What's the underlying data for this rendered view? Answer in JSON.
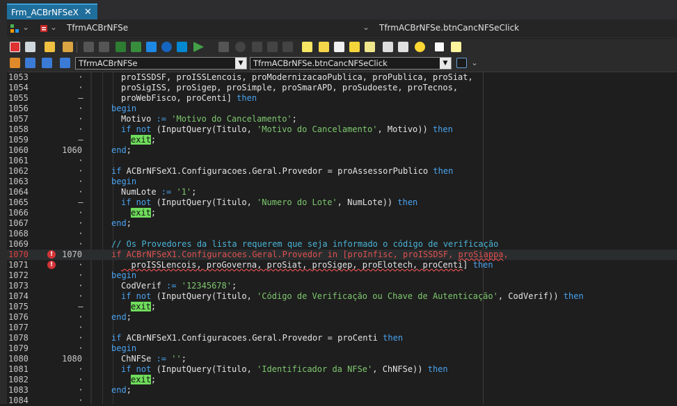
{
  "window": {
    "tab_title": "Frm_ACBrNFSeX",
    "tab_close": "✕"
  },
  "navbar": {
    "unit_class": "TfrmACBrNFSe",
    "method": "TfrmACBrNFSe.btnCancNFSeClick"
  },
  "combo_row": {
    "class_combo": "TfrmACBrNFSe",
    "method_combo": "TfrmACBrNFSe.btnCancNFSeClick"
  },
  "colors": {
    "accent_tab": "#1f6e9c",
    "keyword": "#4aa3f0",
    "string": "#7ec86f",
    "comment": "#4ab3d6",
    "error": "#e05050",
    "exit_highlight": "#6fdc5c"
  },
  "gutter": {
    "error_icon": "error-circle-icon"
  },
  "lines": [
    {
      "n": "1053",
      "m": "",
      "g": "·",
      "tokens": [
        [
          "t",
          "proISSDSF, proISSLencois, proModernizacaoPublica, proPublica, proSiat,"
        ]
      ],
      "indent": 1
    },
    {
      "n": "1054",
      "m": "",
      "g": "·",
      "tokens": [
        [
          "t",
          "proSigISS, proSigep, proSimple, proSmarAPD, proSudoeste, proTecnos,"
        ]
      ],
      "indent": 1
    },
    {
      "n": "1055",
      "m": "",
      "g": "–",
      "tokens": [
        [
          "t",
          "proWebFisco, proCenti] "
        ],
        [
          "kw",
          "then"
        ]
      ],
      "indent": 1
    },
    {
      "n": "1056",
      "m": "",
      "g": "·",
      "tokens": [
        [
          "kw",
          "begin"
        ]
      ],
      "indent": 0
    },
    {
      "n": "1057",
      "m": "",
      "g": "·",
      "tokens": [
        [
          "t",
          "Motivo "
        ],
        [
          "kw",
          ":="
        ],
        [
          "t",
          " "
        ],
        [
          "str",
          "'Motivo do Cancelamento'"
        ],
        [
          "t",
          ";"
        ]
      ],
      "indent": 1
    },
    {
      "n": "1058",
      "m": "",
      "g": "·",
      "tokens": [
        [
          "kw",
          "if not"
        ],
        [
          "t",
          " (InputQuery(Titulo, "
        ],
        [
          "str",
          "'Motivo do Cancelamento'"
        ],
        [
          "t",
          ", Motivo)) "
        ],
        [
          "kw",
          "then"
        ]
      ],
      "indent": 1
    },
    {
      "n": "1059",
      "m": "",
      "g": "–",
      "tokens": [
        [
          "exit",
          "exit"
        ],
        [
          "t",
          ";"
        ]
      ],
      "indent": 2
    },
    {
      "n": "1060",
      "m": "1060",
      "g": "·",
      "tokens": [
        [
          "kw",
          "end"
        ],
        [
          "t",
          ";"
        ]
      ],
      "indent": 0
    },
    {
      "n": "1061",
      "m": "",
      "g": "·",
      "tokens": [],
      "indent": 0
    },
    {
      "n": "1062",
      "m": "",
      "g": "·",
      "tokens": [
        [
          "kw",
          "if"
        ],
        [
          "t",
          " ACBrNFSeX1.Configuracoes.Geral.Provedor = proAssessorPublico "
        ],
        [
          "kw",
          "then"
        ]
      ],
      "indent": 0
    },
    {
      "n": "1063",
      "m": "",
      "g": "·",
      "tokens": [
        [
          "kw",
          "begin"
        ]
      ],
      "indent": 0
    },
    {
      "n": "1064",
      "m": "",
      "g": "·",
      "tokens": [
        [
          "t",
          "NumLote "
        ],
        [
          "kw",
          ":="
        ],
        [
          "t",
          " "
        ],
        [
          "str",
          "'1'"
        ],
        [
          "t",
          ";"
        ]
      ],
      "indent": 1
    },
    {
      "n": "1065",
      "m": "",
      "g": "–",
      "tokens": [
        [
          "kw",
          "if not"
        ],
        [
          "t",
          " (InputQuery(Titulo, "
        ],
        [
          "str",
          "'Numero do Lote'"
        ],
        [
          "t",
          ", NumLote)) "
        ],
        [
          "kw",
          "then"
        ]
      ],
      "indent": 1
    },
    {
      "n": "1066",
      "m": "",
      "g": "·",
      "tokens": [
        [
          "exit",
          "exit"
        ],
        [
          "t",
          ";"
        ]
      ],
      "indent": 2
    },
    {
      "n": "1067",
      "m": "",
      "g": "·",
      "tokens": [
        [
          "kw",
          "end"
        ],
        [
          "t",
          ";"
        ]
      ],
      "indent": 0
    },
    {
      "n": "1068",
      "m": "",
      "g": "·",
      "tokens": [],
      "indent": 0
    },
    {
      "n": "1069",
      "m": "",
      "g": "·",
      "tokens": [
        [
          "cmt",
          "// Os Provedores da lista requerem que seja informado o código de verificação"
        ]
      ],
      "indent": 0
    },
    {
      "n": "1070",
      "m": "1070",
      "g": "·",
      "err": true,
      "current": true,
      "tokens": [
        [
          "red",
          "if ACBrNFSeX1.Configuracoes.Geral.Provedor in [proInfisc, proISSDSF, "
        ],
        [
          "redsq",
          "proSiappa"
        ],
        [
          "red",
          ","
        ]
      ],
      "indent": 0
    },
    {
      "n": "1071",
      "m": "",
      "g": "·",
      "err": false,
      "erricon": true,
      "tokens": [
        [
          "sq",
          "  proISSLencois, proGoverna, proSiat, proSigep, proElotech, proCenti"
        ],
        [
          "t",
          "] "
        ],
        [
          "kw",
          "then"
        ]
      ],
      "indent": 1
    },
    {
      "n": "1072",
      "m": "",
      "g": "·",
      "tokens": [
        [
          "kw",
          "begin"
        ]
      ],
      "indent": 0
    },
    {
      "n": "1073",
      "m": "",
      "g": "·",
      "tokens": [
        [
          "t",
          "CodVerif "
        ],
        [
          "kw",
          ":="
        ],
        [
          "t",
          " "
        ],
        [
          "str",
          "'12345678'"
        ],
        [
          "t",
          ";"
        ]
      ],
      "indent": 1
    },
    {
      "n": "1074",
      "m": "",
      "g": "·",
      "tokens": [
        [
          "kw",
          "if not"
        ],
        [
          "t",
          " (InputQuery(Titulo, "
        ],
        [
          "str",
          "'Código de Verificação ou Chave de Autenticação'"
        ],
        [
          "t",
          ", CodVerif)) "
        ],
        [
          "kw",
          "then"
        ]
      ],
      "indent": 1
    },
    {
      "n": "1075",
      "m": "",
      "g": "–",
      "tokens": [
        [
          "exit",
          "exit"
        ],
        [
          "t",
          ";"
        ]
      ],
      "indent": 2
    },
    {
      "n": "1076",
      "m": "",
      "g": "·",
      "tokens": [
        [
          "kw",
          "end"
        ],
        [
          "t",
          ";"
        ]
      ],
      "indent": 0
    },
    {
      "n": "1077",
      "m": "",
      "g": "·",
      "tokens": [],
      "indent": 0
    },
    {
      "n": "1078",
      "m": "",
      "g": "·",
      "tokens": [
        [
          "kw",
          "if"
        ],
        [
          "t",
          " ACBrNFSeX1.Configuracoes.Geral.Provedor = proCenti "
        ],
        [
          "kw",
          "then"
        ]
      ],
      "indent": 0
    },
    {
      "n": "1079",
      "m": "",
      "g": "·",
      "tokens": [
        [
          "kw",
          "begin"
        ]
      ],
      "indent": 0
    },
    {
      "n": "1080",
      "m": "1080",
      "g": "·",
      "tokens": [
        [
          "t",
          "ChNFSe "
        ],
        [
          "kw",
          ":="
        ],
        [
          "t",
          " "
        ],
        [
          "str",
          "''"
        ],
        [
          "t",
          ";"
        ]
      ],
      "indent": 1
    },
    {
      "n": "1081",
      "m": "",
      "g": "·",
      "tokens": [
        [
          "kw",
          "if not"
        ],
        [
          "t",
          " (InputQuery(Titulo, "
        ],
        [
          "str",
          "'Identificador da NFSe'"
        ],
        [
          "t",
          ", ChNFSe)) "
        ],
        [
          "kw",
          "then"
        ]
      ],
      "indent": 1
    },
    {
      "n": "1082",
      "m": "",
      "g": "·",
      "tokens": [
        [
          "exit",
          "exit"
        ],
        [
          "t",
          ";"
        ]
      ],
      "indent": 2
    },
    {
      "n": "1083",
      "m": "",
      "g": "·",
      "tokens": [
        [
          "kw",
          "end"
        ],
        [
          "t",
          ";"
        ]
      ],
      "indent": 0
    },
    {
      "n": "1084",
      "m": "",
      "g": "·",
      "tokens": [],
      "indent": 0
    }
  ]
}
